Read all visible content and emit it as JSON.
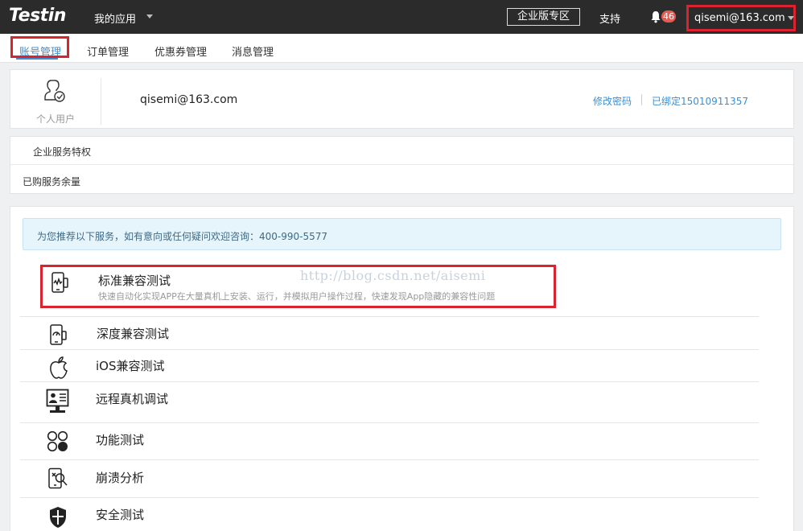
{
  "topbar": {
    "logo": "Testin",
    "my_apps": "我的应用",
    "enterprise_zone": "企业版专区",
    "support": "支持",
    "notification_count": "46",
    "user_email": "qisemi@163.com"
  },
  "subnav": {
    "tabs": [
      {
        "label": "账号管理",
        "active": true
      },
      {
        "label": "订单管理"
      },
      {
        "label": "优惠券管理"
      },
      {
        "label": "消息管理"
      }
    ]
  },
  "account": {
    "user_type": "个人用户",
    "email": "qisemi@163.com",
    "change_password": "修改密码",
    "bound_phone": "已绑定15010911357"
  },
  "services": {
    "enterprise_privileges": "企业服务特权",
    "purchased_balance": "已购服务余量"
  },
  "recommend": {
    "notice": "为您推荐以下服务，如有意向或任何疑问欢迎咨询：400-990-5577",
    "watermark": "http://blog.csdn.net/aisemi",
    "items": [
      {
        "title": "标准兼容测试",
        "desc": "快速自动化实现APP在大量真机上安装、运行，并模拟用户操作过程，快速发现App隐藏的兼容性问题",
        "icon": "phone-chart-icon"
      },
      {
        "title": "深度兼容测试",
        "icon": "phone-gauge-icon"
      },
      {
        "title": "iOS兼容测试",
        "icon": "apple-icon"
      },
      {
        "title": "远程真机调试",
        "icon": "remote-debug-icon"
      },
      {
        "title": "功能测试",
        "icon": "circles-icon"
      },
      {
        "title": "崩溃分析",
        "icon": "crash-search-icon"
      },
      {
        "title": "安全测试",
        "icon": "shield-icon"
      }
    ]
  },
  "colors": {
    "topbar_bg": "#2b2b2b",
    "accent_blue": "#3b8fd6",
    "annotation_red": "#d9232e",
    "badge_red": "#e35b52"
  }
}
